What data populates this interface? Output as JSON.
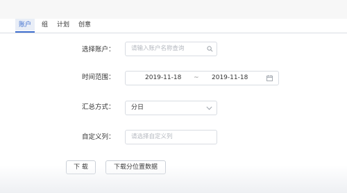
{
  "tabs": [
    {
      "label": "账户",
      "active": true
    },
    {
      "label": "组",
      "active": false
    },
    {
      "label": "计划",
      "active": false
    },
    {
      "label": "创意",
      "active": false
    }
  ],
  "form": {
    "account": {
      "label": "选择账户：",
      "placeholder": "请输入账户名称查询",
      "icon": "search-icon"
    },
    "time_range": {
      "label": "时间范围：",
      "start": "2019-11-18",
      "separator": "~",
      "end": "2019-11-18",
      "icon": "calendar-icon"
    },
    "summary": {
      "label": "汇总方式：",
      "value": "分日",
      "icon": "chevron-down-icon"
    },
    "custom_columns": {
      "label": "自定义列：",
      "placeholder": "请选择自定义列"
    }
  },
  "buttons": {
    "download": "下 载",
    "download_positions": "下载分位置数据"
  },
  "colors": {
    "accent": "#3f6fcf",
    "border": "#d8dce2",
    "placeholder": "#b5b9c0"
  }
}
